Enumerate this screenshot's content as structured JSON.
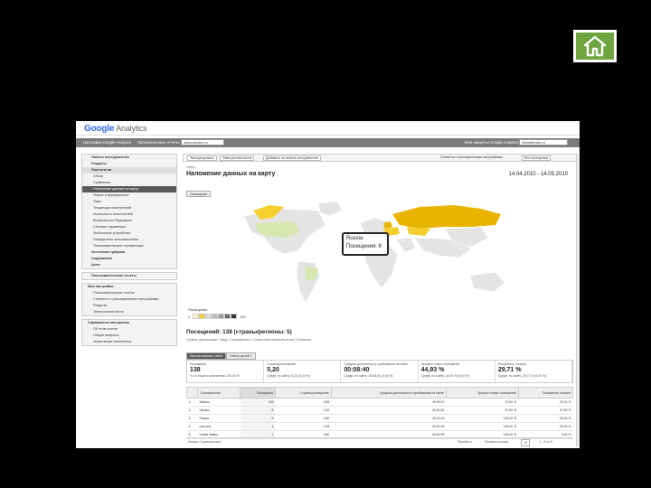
{
  "home_icon": "home-icon",
  "ga": {
    "logo_google": "Google",
    "logo_analytics": "Analytics",
    "nav": {
      "settings": "Настройки Google Analytics",
      "my_reports": "Просмотренные отчеты:",
      "site": "www.wecker.ru",
      "my_account": "Мои аккаунты Google Analytics:",
      "account": "Vamdeteme.ru"
    }
  },
  "sidebar": {
    "top_items": [
      "Панель инструментов",
      "Разделы",
      "Посетители"
    ],
    "visitor_items": [
      "Обзор",
      "Сравнение",
      "Наложение данных на карту",
      "Новые и вернувшиеся",
      "Язык",
      "Тенденции посетителей",
      "Лояльность посетителей",
      "Возможности браузеров",
      "Сетевые параметры",
      "Мобильные устройства",
      "Определено пользователем",
      "Пользовательские переменные"
    ],
    "bottom_items": [
      "Источники трафика",
      "Содержание",
      "Цели"
    ],
    "custom_reports": "Пользовательские отчеты",
    "my_settings_title": "Мои настройки",
    "my_settings_items": [
      "Пользовательские отчеты",
      "Сегменты с расширенными настройками",
      "Разделы",
      "Электронная почта"
    ],
    "help_title": "Справочные материалы",
    "help_items": [
      "Об этом отчете",
      "Общие вопросы",
      "Уникальные посетители"
    ]
  },
  "main": {
    "toolbar": [
      "Экспортировать",
      "Электронная почта",
      "Добавить на панель инструментов",
      "Сегменты с расширенными настройками",
      "Все посещения"
    ],
    "crumb": "Обзор",
    "title": "Наложение данных на карту",
    "date_range": "14.04.2010 - 14.05.2010",
    "view_label": "Посещения",
    "tooltip_country": "Russia",
    "tooltip_visits": "Посещения: 6",
    "legend_title": "Посещения",
    "legend_min": "1",
    "legend_max": "119",
    "summary_title": "Посещений: 138 (страны/регионы: 5)",
    "dims_label": "Уровень детализации: Город | Страна/регион | Субконтинентальный регион | Континент",
    "tabs": [
      "Использование сайта",
      "Набор целей 1"
    ],
    "metrics": [
      {
        "label": "Посещения",
        "value": "138",
        "sub": "% от общего количества: 100,00 %"
      },
      {
        "label": "Страниц/посещение",
        "value": "5,20",
        "sub": "Средн. по сайту: 5,20 (0,00 %)"
      },
      {
        "label": "Средняя длительность пребывания на сайте",
        "value": "00:08:40",
        "sub": "Средн. по сайту: 00:08:40 (0,00 %)"
      },
      {
        "label": "Процент новых посещений",
        "value": "44,93 %",
        "sub": "Средн. по сайту: 44,93 % (0,00 %)"
      },
      {
        "label": "Показатель отказов",
        "value": "29,71 %",
        "sub": "Средн. по сайту: 29,71 % (0,00 %)"
      }
    ],
    "columns": [
      "",
      "Страна/регион",
      "Посещения",
      "Страниц/посещение",
      "Средняя длительность пребывания на сайте",
      "Процент новых посещений",
      "Показатель отказов"
    ],
    "rows": [
      [
        "1.",
        "Belarus",
        "119",
        "5,89",
        "00:09:11",
        "37,82 %",
        "29,41 %"
      ],
      [
        "2.",
        "Ukraine",
        "8",
        "2,00",
        "00:02:51",
        "87,50 %",
        "37,50 %"
      ],
      [
        "3.",
        "Russia",
        "6",
        "2,50",
        "00:11:13",
        "100,00 %",
        "50,00 %"
      ],
      [
        "4.",
        "(not set)",
        "4",
        "2,25",
        "00:02:30",
        "100,00 %",
        "25,00 %"
      ],
      [
        "5.",
        "United States",
        "1",
        "3,00",
        "00:04:09",
        "100,00 %",
        "0,00 %"
      ]
    ],
    "pager_filter": "Фильтр Страна/регион:",
    "pager_go": "Перейти к:",
    "pager_count": "1 – 5 из 5",
    "pager_show": "Показать строки:",
    "pager_rows": "10"
  },
  "colors": {
    "map_high": "#e8b400",
    "map_mid": "#f5cf2e",
    "map_low": "#d8e6b0",
    "map_empty": "#e4e4e4",
    "home_green": "#6fa53f"
  }
}
